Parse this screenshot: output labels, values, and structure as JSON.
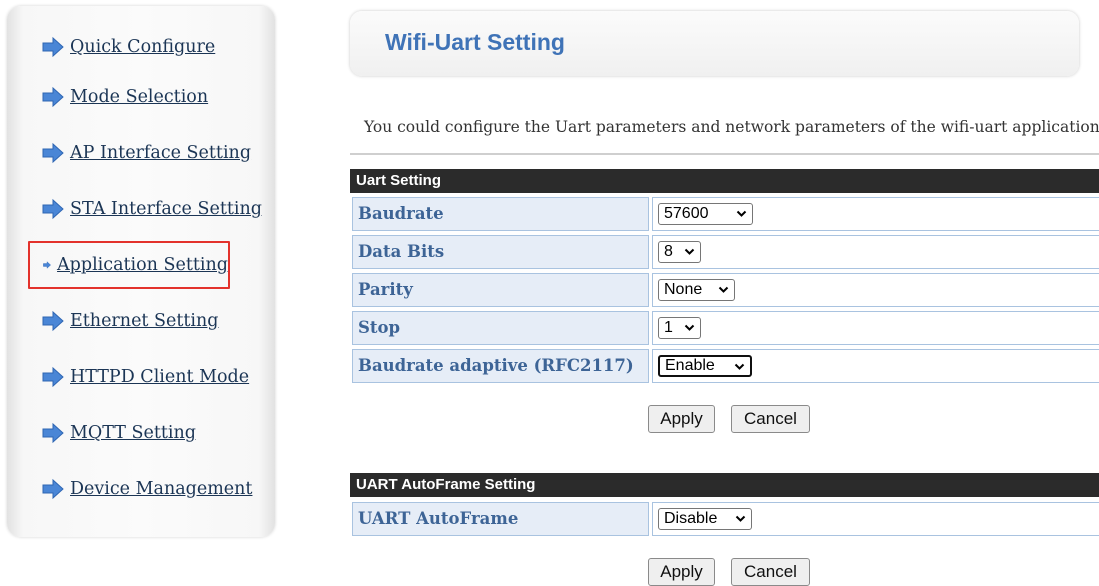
{
  "sidebar": {
    "items": [
      {
        "label": "Quick Configure"
      },
      {
        "label": "Mode Selection"
      },
      {
        "label": "AP Interface Setting"
      },
      {
        "label": "STA Interface Setting"
      },
      {
        "label": "Application Setting",
        "active": true
      },
      {
        "label": "Ethernet Setting"
      },
      {
        "label": "HTTPD Client Mode"
      },
      {
        "label": "MQTT Setting"
      },
      {
        "label": "Device Management"
      }
    ],
    "icon": "right-arrow-icon",
    "icon_color": "#4a86d6",
    "highlight_color": "#e3322c"
  },
  "page": {
    "title": "Wifi-Uart Setting",
    "description": "You could configure the Uart parameters and network parameters of the wifi-uart application."
  },
  "uart_setting": {
    "header": "Uart Setting",
    "rows": [
      {
        "label": "Baudrate",
        "value": "57600"
      },
      {
        "label": "Data Bits",
        "value": "8"
      },
      {
        "label": "Parity",
        "value": "None"
      },
      {
        "label": "Stop",
        "value": "1"
      },
      {
        "label": "Baudrate adaptive (RFC2117)",
        "value": "Enable"
      }
    ],
    "apply_label": "Apply",
    "cancel_label": "Cancel"
  },
  "autoframe_setting": {
    "header": "UART AutoFrame Setting",
    "rows": [
      {
        "label": "UART AutoFrame",
        "value": "Disable"
      }
    ],
    "apply_label": "Apply",
    "cancel_label": "Cancel"
  },
  "colors": {
    "title": "#3f73b7",
    "label_text": "#3d6496",
    "label_bg": "#e6edf7",
    "header_bg": "#2b2b2b"
  }
}
